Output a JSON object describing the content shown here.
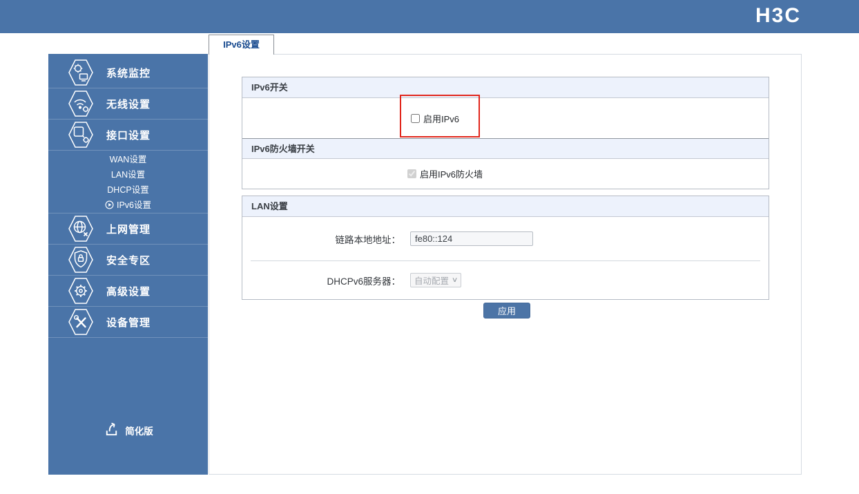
{
  "header": {
    "logo_text": "H3C",
    "bg_color": "#4a74a8"
  },
  "tab": {
    "label": "IPv6设置"
  },
  "sidebar": {
    "items": [
      {
        "label": "系统监控",
        "icon": "system-monitor-icon"
      },
      {
        "label": "无线设置",
        "icon": "wireless-settings-icon"
      },
      {
        "label": "接口设置",
        "icon": "interface-settings-icon"
      },
      {
        "label": "上网管理",
        "icon": "internet-management-icon"
      },
      {
        "label": "安全专区",
        "icon": "security-zone-icon"
      },
      {
        "label": "高级设置",
        "icon": "advanced-settings-icon"
      },
      {
        "label": "设备管理",
        "icon": "device-management-icon"
      }
    ],
    "submenu": {
      "items": [
        {
          "label": "WAN设置",
          "active": false
        },
        {
          "label": "LAN设置",
          "active": false
        },
        {
          "label": "DHCP设置",
          "active": false
        },
        {
          "label": "IPv6设置",
          "active": true
        }
      ]
    },
    "simplified_link": {
      "label": "简化版"
    }
  },
  "content": {
    "sections": {
      "ipv6_switch": {
        "title": "IPv6开关",
        "checkbox_label": "启用IPv6",
        "checked": false,
        "highlighted": true
      },
      "ipv6_firewall": {
        "title": "IPv6防火墙开关",
        "checkbox_label": "启用IPv6防火墙",
        "checked": true,
        "disabled": true
      },
      "lan": {
        "title": "LAN设置",
        "fields": {
          "link_local": {
            "label": "链路本地地址：",
            "value": "fe80::124",
            "disabled": true
          },
          "dhcpv6": {
            "label": "DHCPv6服务器：",
            "value": "自动配置",
            "disabled": true
          }
        }
      }
    },
    "apply_label": "应用"
  },
  "colors": {
    "brand_blue": "#4a74a8",
    "section_header_bg": "#edf2fc",
    "highlight_red": "#e1251b",
    "tab_text_blue": "#184a8f"
  }
}
